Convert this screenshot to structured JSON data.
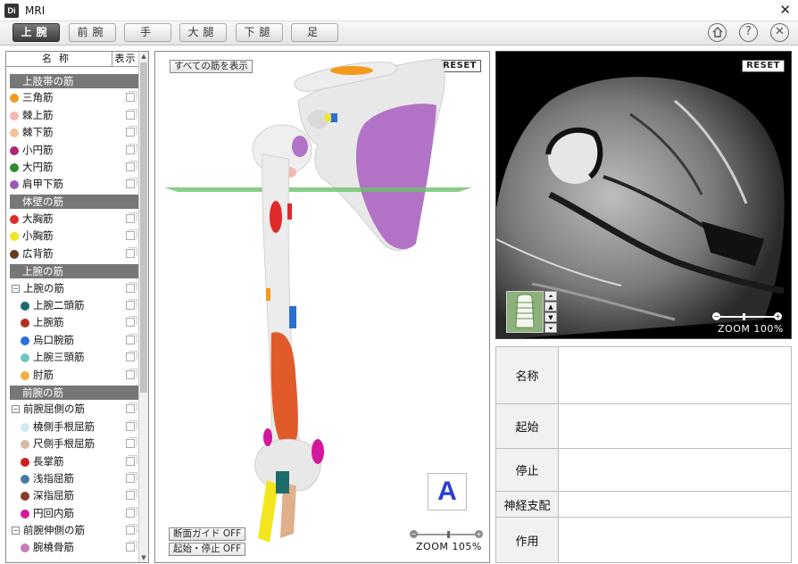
{
  "window": {
    "app_icon": "Di",
    "title": "MRI",
    "close": "✕"
  },
  "tabs": [
    {
      "label": "上腕",
      "active": true
    },
    {
      "label": "前腕",
      "active": false
    },
    {
      "label": "手",
      "active": false
    },
    {
      "label": "大腿",
      "active": false
    },
    {
      "label": "下腿",
      "active": false
    },
    {
      "label": "足",
      "active": false
    }
  ],
  "toolbar_icons": [
    "home-icon",
    "help-icon",
    "close-circle-icon"
  ],
  "muscle_list": {
    "header_name": "名称",
    "header_show": "表示",
    "rows": [
      {
        "type": "group",
        "label": "上肢帯の筋"
      },
      {
        "type": "item",
        "label": "三角筋",
        "color": "#f39a1c"
      },
      {
        "type": "item",
        "label": "棘上筋",
        "color": "#f5b7b1"
      },
      {
        "type": "item",
        "label": "棘下筋",
        "color": "#f2c19a"
      },
      {
        "type": "item",
        "label": "小円筋",
        "color": "#b0257a"
      },
      {
        "type": "item",
        "label": "大円筋",
        "color": "#2e8b2e"
      },
      {
        "type": "item",
        "label": "肩甲下筋",
        "color": "#9b59b6"
      },
      {
        "type": "group",
        "label": "体壁の筋"
      },
      {
        "type": "item",
        "label": "大胸筋",
        "color": "#e02a2a"
      },
      {
        "type": "item",
        "label": "小胸筋",
        "color": "#f2e61c"
      },
      {
        "type": "item",
        "label": "広背筋",
        "color": "#6a3a1a"
      },
      {
        "type": "group",
        "label": "上腕の筋"
      },
      {
        "type": "subgroup",
        "label": "上腕の筋"
      },
      {
        "type": "item",
        "label": "上腕二頭筋",
        "color": "#1d6b6b",
        "indent": true
      },
      {
        "type": "item",
        "label": "上腕筋",
        "color": "#b03020",
        "indent": true
      },
      {
        "type": "item",
        "label": "烏口腕筋",
        "color": "#2a6fd6",
        "indent": true
      },
      {
        "type": "item",
        "label": "上腕三頭筋",
        "color": "#72c4c4",
        "indent": true
      },
      {
        "type": "item",
        "label": "肘筋",
        "color": "#f0b040",
        "indent": true
      },
      {
        "type": "group",
        "label": "前腕の筋"
      },
      {
        "type": "subgroup",
        "label": "前腕屈側の筋"
      },
      {
        "type": "item",
        "label": "橈側手根屈筋",
        "color": "#cfe8f2",
        "indent": true
      },
      {
        "type": "item",
        "label": "尺側手根屈筋",
        "color": "#d9b9a6",
        "indent": true
      },
      {
        "type": "item",
        "label": "長掌筋",
        "color": "#cc2020",
        "indent": true
      },
      {
        "type": "item",
        "label": "浅指屈筋",
        "color": "#4a7aa8",
        "indent": true
      },
      {
        "type": "item",
        "label": "深指屈筋",
        "color": "#8a3a2a",
        "indent": true
      },
      {
        "type": "item",
        "label": "円回内筋",
        "color": "#d4189c",
        "indent": true
      },
      {
        "type": "subgroup",
        "label": "前腕伸側の筋"
      },
      {
        "type": "item",
        "label": "腕橈骨筋",
        "color": "#c77ab8",
        "indent": true
      }
    ]
  },
  "viewer3d": {
    "show_all_button": "すべての筋を表示",
    "reset": "RESET",
    "guide_button": "断面ガイド OFF",
    "origin_button": "起始・停止 OFF",
    "zoom_label": "ZOOM 105%",
    "zoom_level": 105,
    "view_letter": "A"
  },
  "mri": {
    "reset": "RESET",
    "zoom_label": "ZOOM 100%",
    "zoom_level": 100
  },
  "info": [
    {
      "label": "名称",
      "value": ""
    },
    {
      "label": "起始",
      "value": ""
    },
    {
      "label": "停止",
      "value": ""
    },
    {
      "label": "神経支配",
      "value": ""
    },
    {
      "label": "作用",
      "value": ""
    }
  ]
}
